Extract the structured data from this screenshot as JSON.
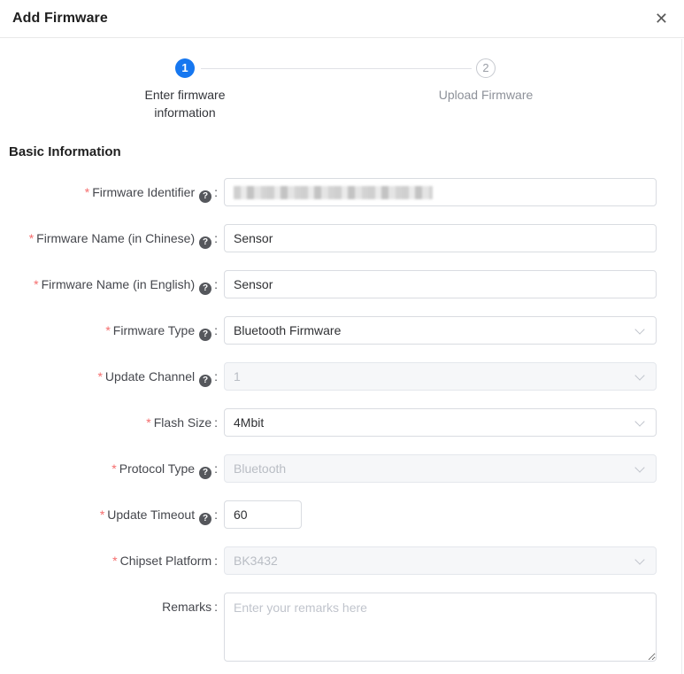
{
  "dialog": {
    "title": "Add Firmware",
    "close_glyph": "✕"
  },
  "steps": {
    "items": [
      {
        "number": "1",
        "label": "Enter firmware information",
        "state": "active"
      },
      {
        "number": "2",
        "label": "Upload Firmware",
        "state": "pending"
      }
    ]
  },
  "section": {
    "title": "Basic Information"
  },
  "form": {
    "help_glyph": "?",
    "required_marker": "*",
    "colon": ":",
    "fields": [
      {
        "id": "firmware-identifier",
        "label": "Firmware Identifier",
        "required": true,
        "help": true,
        "control": "text",
        "value": "",
        "redacted": true
      },
      {
        "id": "firmware-name-chinese",
        "label": "Firmware Name (in Chinese)",
        "required": true,
        "help": true,
        "control": "text",
        "value": "Sensor"
      },
      {
        "id": "firmware-name-english",
        "label": "Firmware Name (in English)",
        "required": true,
        "help": true,
        "control": "text",
        "value": "Sensor"
      },
      {
        "id": "firmware-type",
        "label": "Firmware Type",
        "required": true,
        "help": true,
        "control": "select",
        "value": "Bluetooth Firmware",
        "disabled": false
      },
      {
        "id": "update-channel",
        "label": "Update Channel",
        "required": true,
        "help": true,
        "control": "select",
        "value": "1",
        "disabled": true
      },
      {
        "id": "flash-size",
        "label": "Flash Size",
        "required": true,
        "help": false,
        "control": "select",
        "value": "4Mbit",
        "disabled": false
      },
      {
        "id": "protocol-type",
        "label": "Protocol Type",
        "required": true,
        "help": true,
        "control": "select",
        "value": "Bluetooth",
        "disabled": true
      },
      {
        "id": "update-timeout",
        "label": "Update Timeout",
        "required": true,
        "help": true,
        "control": "text",
        "value": "60",
        "small": true
      },
      {
        "id": "chipset-platform",
        "label": "Chipset Platform",
        "required": true,
        "help": false,
        "control": "select",
        "value": "BK3432",
        "disabled": true
      },
      {
        "id": "remarks",
        "label": "Remarks",
        "required": false,
        "help": false,
        "control": "textarea",
        "value": "",
        "placeholder": "Enter your remarks here"
      }
    ]
  },
  "colors": {
    "accent_blue": "#1677f0",
    "required_red": "#f56c6c",
    "border": "#d9dce1",
    "disabled_bg": "#f6f7f9",
    "disabled_text": "#b9bdc4",
    "placeholder": "#c0c4cc"
  }
}
